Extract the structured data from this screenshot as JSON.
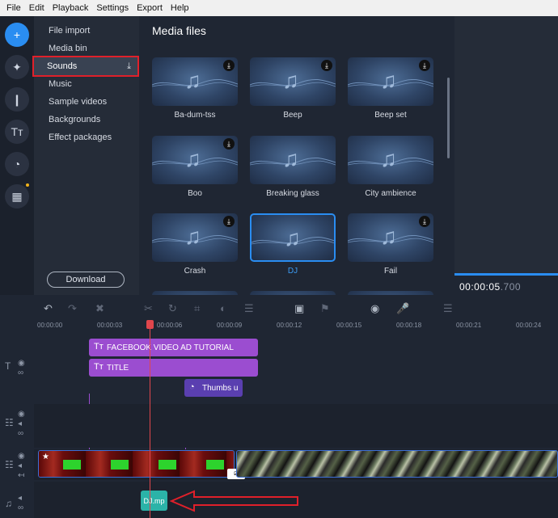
{
  "menu": [
    {
      "label": "File",
      "key": "F"
    },
    {
      "label": "Edit",
      "key": "E"
    },
    {
      "label": "Playback",
      "key": "P"
    },
    {
      "label": "Settings",
      "key": "S"
    },
    {
      "label": "Export",
      "key": ""
    },
    {
      "label": "Help",
      "key": "H"
    }
  ],
  "sidebar": {
    "categories": [
      {
        "label": "File import"
      },
      {
        "label": "Media bin"
      },
      {
        "label": "Sounds",
        "selected": true
      },
      {
        "label": "Music"
      },
      {
        "label": "Sample videos"
      },
      {
        "label": "Backgrounds"
      },
      {
        "label": "Effect packages"
      }
    ],
    "download_label": "Download"
  },
  "media": {
    "title": "Media files",
    "items": [
      {
        "label": "Ba-dum-tss",
        "downloadable": true
      },
      {
        "label": "Beep",
        "downloadable": true
      },
      {
        "label": "Beep set",
        "downloadable": true
      },
      {
        "label": "Boo",
        "downloadable": true
      },
      {
        "label": "Breaking glass",
        "downloadable": false
      },
      {
        "label": "City ambience",
        "downloadable": false
      },
      {
        "label": "Crash",
        "downloadable": true
      },
      {
        "label": "DJ",
        "downloadable": false,
        "selected": true
      },
      {
        "label": "Fail",
        "downloadable": true
      }
    ]
  },
  "preview": {
    "time_main": "00:00:05",
    "time_ms": ".700"
  },
  "timeline": {
    "ruler": [
      "00:00:00",
      "00:00:03",
      "00:00:06",
      "00:00:09",
      "00:00:12",
      "00:00:15",
      "00:00:18",
      "00:00:21",
      "00:00:24"
    ],
    "title_clips": [
      "FACEBOOK VIDEO AD TUTORIAL",
      "TITLE"
    ],
    "sticker_clip": "Thumbs u",
    "audio_clip": "DJ.mp"
  },
  "colors": {
    "accent": "#2a8df1",
    "highlight": "#e0202a",
    "title_clip": "#9b4dd0",
    "sticker_clip": "#5a3fb0",
    "audio_clip": "#2bb3a8"
  }
}
